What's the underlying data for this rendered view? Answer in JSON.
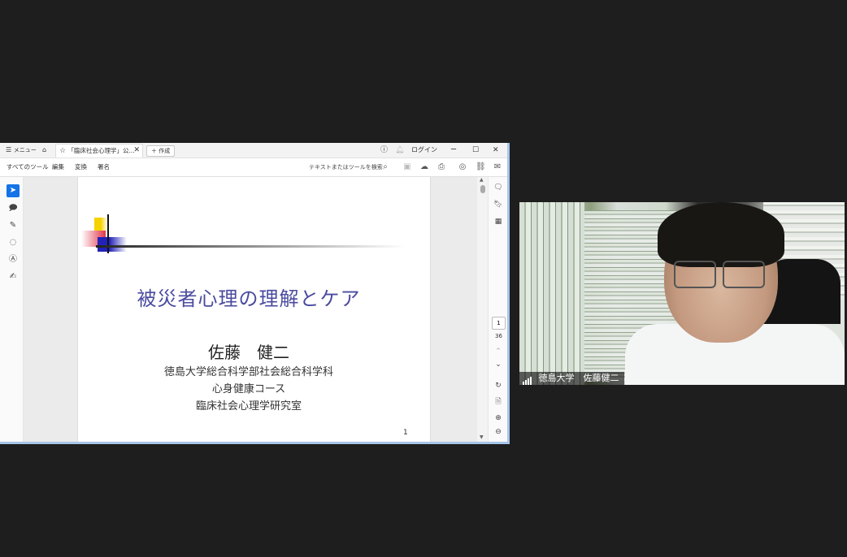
{
  "titlebar": {
    "menu_label": "メニュー",
    "tab_title": "「臨床社会心理学」公...",
    "create_label": "作成",
    "login_label": "ログイン"
  },
  "menubar": {
    "items": [
      "すべてのツール",
      "編集",
      "変換",
      "署名"
    ],
    "search_text": "テキストまたはツールを検索"
  },
  "slide": {
    "title": "被災者心理の理解とケア",
    "author": "佐藤　健二",
    "affiliation_1": "徳島大学総合科学部社会総合科学科",
    "affiliation_2": "心身健康コース",
    "affiliation_3": "臨床社会心理学研究室",
    "page_number": "1"
  },
  "navigation": {
    "current_page": "1",
    "total_pages": "36"
  },
  "video": {
    "participant_name": "徳島大学　佐藤健二"
  },
  "colors": {
    "accent": "#1473e6",
    "title_color": "#4b4ba0"
  }
}
